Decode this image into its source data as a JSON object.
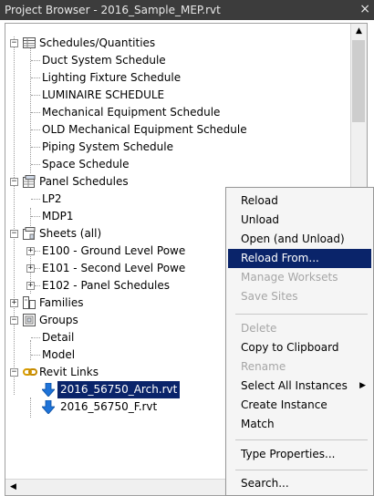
{
  "window": {
    "title": "Project Browser - 2016_Sample_MEP.rvt",
    "close_glyph": "×"
  },
  "tree": {
    "schedules": {
      "label": "Schedules/Quantities",
      "expander": "−",
      "items": [
        "Duct System Schedule",
        "Lighting Fixture Schedule",
        "LUMINAIRE SCHEDULE",
        "Mechanical Equipment Schedule",
        "OLD Mechanical Equipment Schedule",
        "Piping System Schedule",
        "Space Schedule"
      ]
    },
    "panel_schedules": {
      "label": "Panel Schedules",
      "expander": "−",
      "items": [
        "LP2",
        "MDP1"
      ]
    },
    "sheets": {
      "label": "Sheets (all)",
      "expander": "−",
      "items": [
        {
          "label": "E100 - Ground Level Powe",
          "expander": "+"
        },
        {
          "label": "E101 - Second Level Powe",
          "expander": "+"
        },
        {
          "label": "E102 - Panel Schedules",
          "expander": "+"
        }
      ]
    },
    "families": {
      "label": "Families",
      "expander": "+"
    },
    "groups": {
      "label": "Groups",
      "expander": "−",
      "items": [
        "Detail",
        "Model"
      ]
    },
    "revit_links": {
      "label": "Revit Links",
      "expander": "−",
      "items": [
        "2016_56750_Arch.rvt",
        "2016_56750_F.rvt"
      ]
    }
  },
  "scrollbar": {
    "up": "▲",
    "left": "◀"
  },
  "context_menu": {
    "items": [
      {
        "label": "Reload",
        "state": "normal"
      },
      {
        "label": "Unload",
        "state": "normal"
      },
      {
        "label": "Open (and Unload)",
        "state": "normal"
      },
      {
        "label": "Reload From...",
        "state": "highlighted"
      },
      {
        "label": "Manage Worksets",
        "state": "disabled"
      },
      {
        "label": "Save Sites",
        "state": "disabled"
      },
      {
        "label": "Delete",
        "state": "disabled"
      },
      {
        "label": "Copy to Clipboard",
        "state": "normal"
      },
      {
        "label": "Rename",
        "state": "disabled"
      },
      {
        "label": "Select All Instances",
        "state": "normal",
        "submenu_arrow": "▶"
      },
      {
        "label": "Create Instance",
        "state": "normal"
      },
      {
        "label": "Match",
        "state": "normal"
      },
      {
        "label": "Type Properties...",
        "state": "normal"
      },
      {
        "label": "Search...",
        "state": "normal"
      }
    ]
  },
  "colors": {
    "selection": "#0a246a",
    "titlebar": "#3c3c3c",
    "link_arrow": "#1e73d8",
    "disabled_text": "#a6a6a6"
  }
}
